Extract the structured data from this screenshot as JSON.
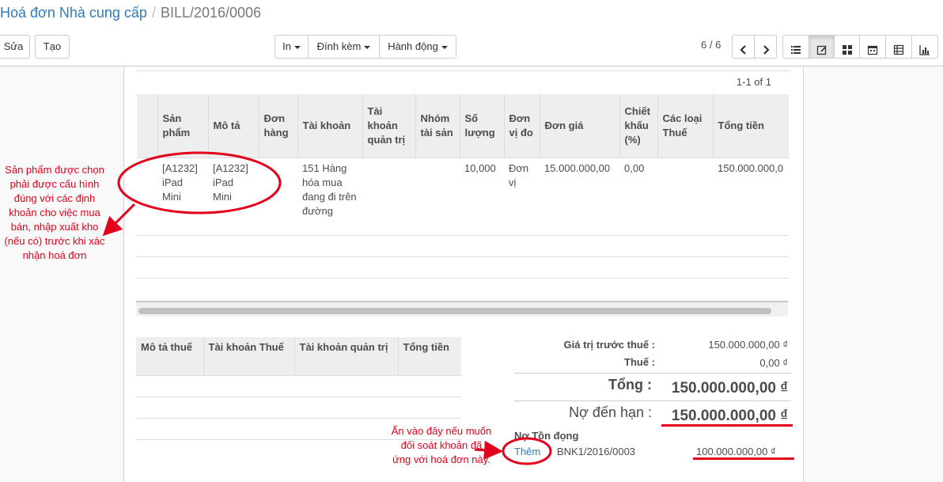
{
  "breadcrumb": {
    "parent": "Hoá đơn Nhà cung cấp",
    "separator": "/",
    "current": "BILL/2016/0006"
  },
  "toolbar": {
    "edit_label": "Sửa",
    "create_label": "Tạo",
    "print_label": "In",
    "attach_label": "Đính kèm",
    "action_label": "Hành động",
    "pager_value": "6 / 6"
  },
  "views": [
    "list-view-icon",
    "form-view-icon",
    "kanban-view-icon",
    "calendar-view-icon",
    "pivot-view-icon",
    "graph-view-icon"
  ],
  "lines": {
    "pager": "1-1 of 1",
    "headers": [
      "Sản phẩm",
      "Mô tả",
      "Đơn hàng",
      "Tài khoản",
      "Tài khoản quản trị",
      "Nhóm tài sản",
      "Số lượng",
      "Đơn vị đo",
      "Đơn giá",
      "Chiết khấu (%)",
      "Các loại Thuế",
      "Tổng tiền"
    ],
    "rows": [
      {
        "product": "[A1232] iPad Mini",
        "description": "[A1232] iPad Mini",
        "order": "",
        "account": "151 Hàng hóa mua đang đi trên đường",
        "analytic": "",
        "asset": "",
        "quantity": "10,000",
        "uom": "Đơn vị",
        "price": "15.000.000,00",
        "discount": "0,00",
        "taxes": "",
        "subtotal": "150.000.000,0"
      }
    ]
  },
  "taxes_table": {
    "headers": [
      "Mô tả thuế",
      "Tài khoản Thuế",
      "Tài khoản quản trị",
      "Tổng tiền"
    ]
  },
  "totals": {
    "untaxed_label": "Giá trị trước thuế :",
    "untaxed_value": "150.000.000,00 ₫",
    "tax_label": "Thuế :",
    "tax_value": "0,00 ₫",
    "total_label": "Tổng :",
    "total_value": "150.000.000,00 ₫",
    "due_label": "Nợ đến hạn :",
    "due_value": "150.000.000,00 ₫"
  },
  "outstanding": {
    "title": "Nợ Tồn đọng",
    "add_label": "Thêm",
    "reference": "BNK1/2016/0003",
    "amount": "100.000.000,00 ₫"
  },
  "annotations": {
    "product_note": "Sản phẩm được chọn phải được cấu hình đúng với các định khoản cho việc mua bán, nhập xuất kho (nếu có) trước khi xác nhận hoá đơn",
    "add_note": "Ấn vào đây nếu muốn đối soát khoản đã ứng với hoá đơn này.",
    "annotation_color": "#e3001b"
  },
  "colors": {
    "link": "#337ab7",
    "header_bg": "#eeeeee",
    "annotation": "#e3001b"
  }
}
